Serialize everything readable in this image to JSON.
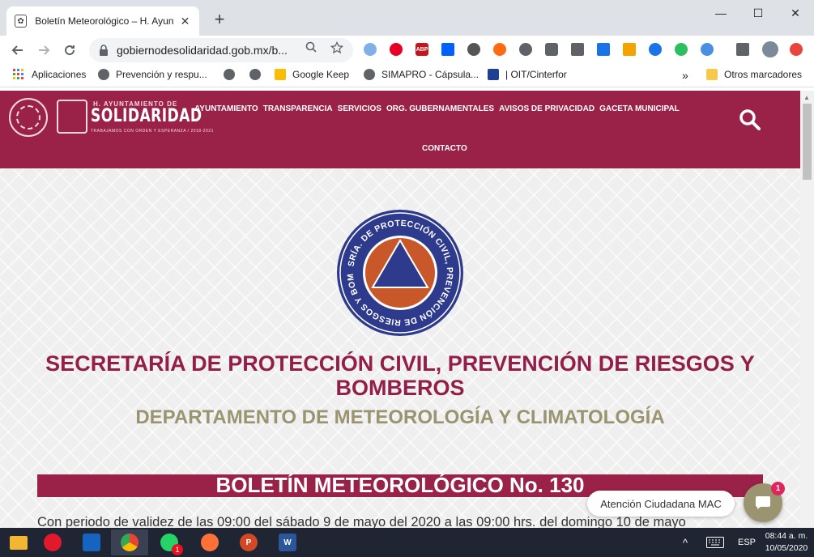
{
  "browser": {
    "tab": {
      "title": "Boletín Meteorológico – H. Ayunta",
      "close": "✕"
    },
    "new_tab": "+",
    "window_controls": {
      "minimize": "—",
      "maximize": "☐",
      "close": "✕"
    },
    "address_bar": {
      "url": "gobiernodesolidaridad.gob.mx/b..."
    },
    "bookmarks": [
      {
        "label": "Aplicaciones"
      },
      {
        "label": "Prevención y respu..."
      },
      {
        "label": ""
      },
      {
        "label": ""
      },
      {
        "label": "Google Keep"
      },
      {
        "label": "SIMAPRO - Cápsula..."
      },
      {
        "label": "| OIT/Cinterfor"
      }
    ],
    "bookmarks_overflow": "»",
    "other_bookmarks": "Otros marcadores",
    "extensions": [
      "abp-icon"
    ],
    "extension_abp_label": "ABP"
  },
  "site": {
    "logo": {
      "small": "H. AYUNTAMIENTO DE",
      "main": "SOLIDARIDAD",
      "tagline": "TRABAJAMOS CON ORDEN Y ESPERANZA / 2018-2021"
    },
    "menu": [
      "AYUNTAMIENTO",
      "TRANSPARENCIA",
      "SERVICIOS",
      "ORG. GUBERNAMENTALES",
      "AVISOS DE PRIVACIDAD",
      "GACETA MUNICIPAL"
    ],
    "menu_contact": "CONTACTO",
    "emblem_text": "SRÍA. DE PROTECCIÓN CIVIL, PREVENCIÓN DE RIESGOS Y BOMBEROS ·",
    "title": "SECRETARÍA DE PROTECCIÓN CIVIL, PREVENCIÓN DE RIESGOS Y BOMBEROS",
    "department": "DEPARTAMENTO DE METEOROLOGÍA Y CLIMATOLOGÍA",
    "bulletin": "BOLETÍN METEOROLÓGICO No. 130",
    "validity": "Con periodo de validez de las 09:00 del sábado 9 de mayo del 2020 a las 09:00 hrs. del domingo 10 de mayo",
    "chat": {
      "label": "Atención Ciudadana MAC",
      "badge": "1"
    }
  },
  "taskbar": {
    "whatsapp_badge": "1",
    "powerpoint_letter": "P",
    "word_letter": "W",
    "tray_chevron": "^",
    "language": "ESP",
    "time": "08:44 a. m.",
    "date": "10/05/2020"
  },
  "colors": {
    "brand": "#9a2148",
    "title": "#931f48",
    "department": "#9a9470",
    "chat_button": "#9a9470",
    "emblem_orange": "#c8572a",
    "emblem_blue": "#2e3a8c"
  }
}
